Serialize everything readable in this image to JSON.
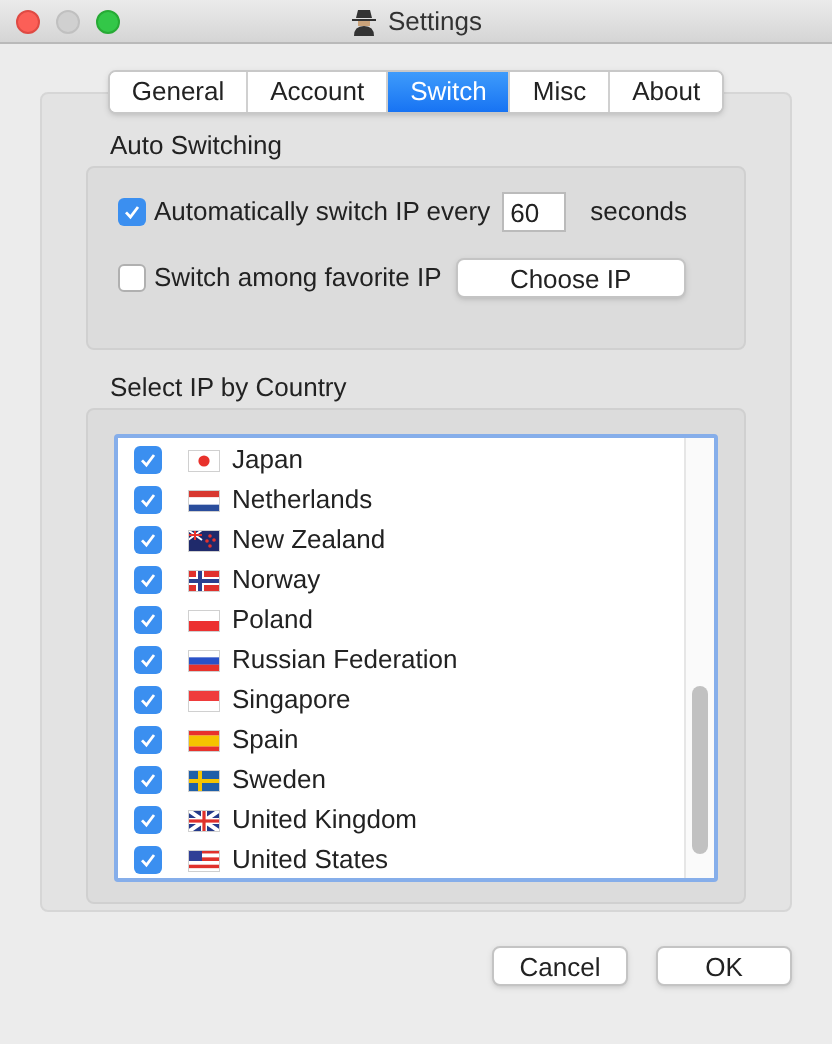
{
  "window": {
    "title": "Settings"
  },
  "tabs": [
    {
      "label": "General",
      "selected": false
    },
    {
      "label": "Account",
      "selected": false
    },
    {
      "label": "Switch",
      "selected": true
    },
    {
      "label": "Misc",
      "selected": false
    },
    {
      "label": "About",
      "selected": false
    }
  ],
  "auto_switching": {
    "title": "Auto Switching",
    "auto_switch": {
      "label": "Automatically switch IP every",
      "checked": true,
      "value": "60",
      "unit": "seconds"
    },
    "favorite": {
      "label": "Switch among favorite IP",
      "checked": false,
      "button": "Choose IP"
    }
  },
  "country_list": {
    "title": "Select IP by Country",
    "items": [
      {
        "name": "Japan",
        "checked": true
      },
      {
        "name": "Netherlands",
        "checked": true
      },
      {
        "name": "New Zealand",
        "checked": true
      },
      {
        "name": "Norway",
        "checked": true
      },
      {
        "name": "Poland",
        "checked": true
      },
      {
        "name": "Russian Federation",
        "checked": true
      },
      {
        "name": "Singapore",
        "checked": true
      },
      {
        "name": "Spain",
        "checked": true
      },
      {
        "name": "Sweden",
        "checked": true
      },
      {
        "name": "United Kingdom",
        "checked": true
      },
      {
        "name": "United States",
        "checked": true
      }
    ]
  },
  "buttons": [
    {
      "label": "Cancel"
    },
    {
      "label": "OK"
    }
  ]
}
